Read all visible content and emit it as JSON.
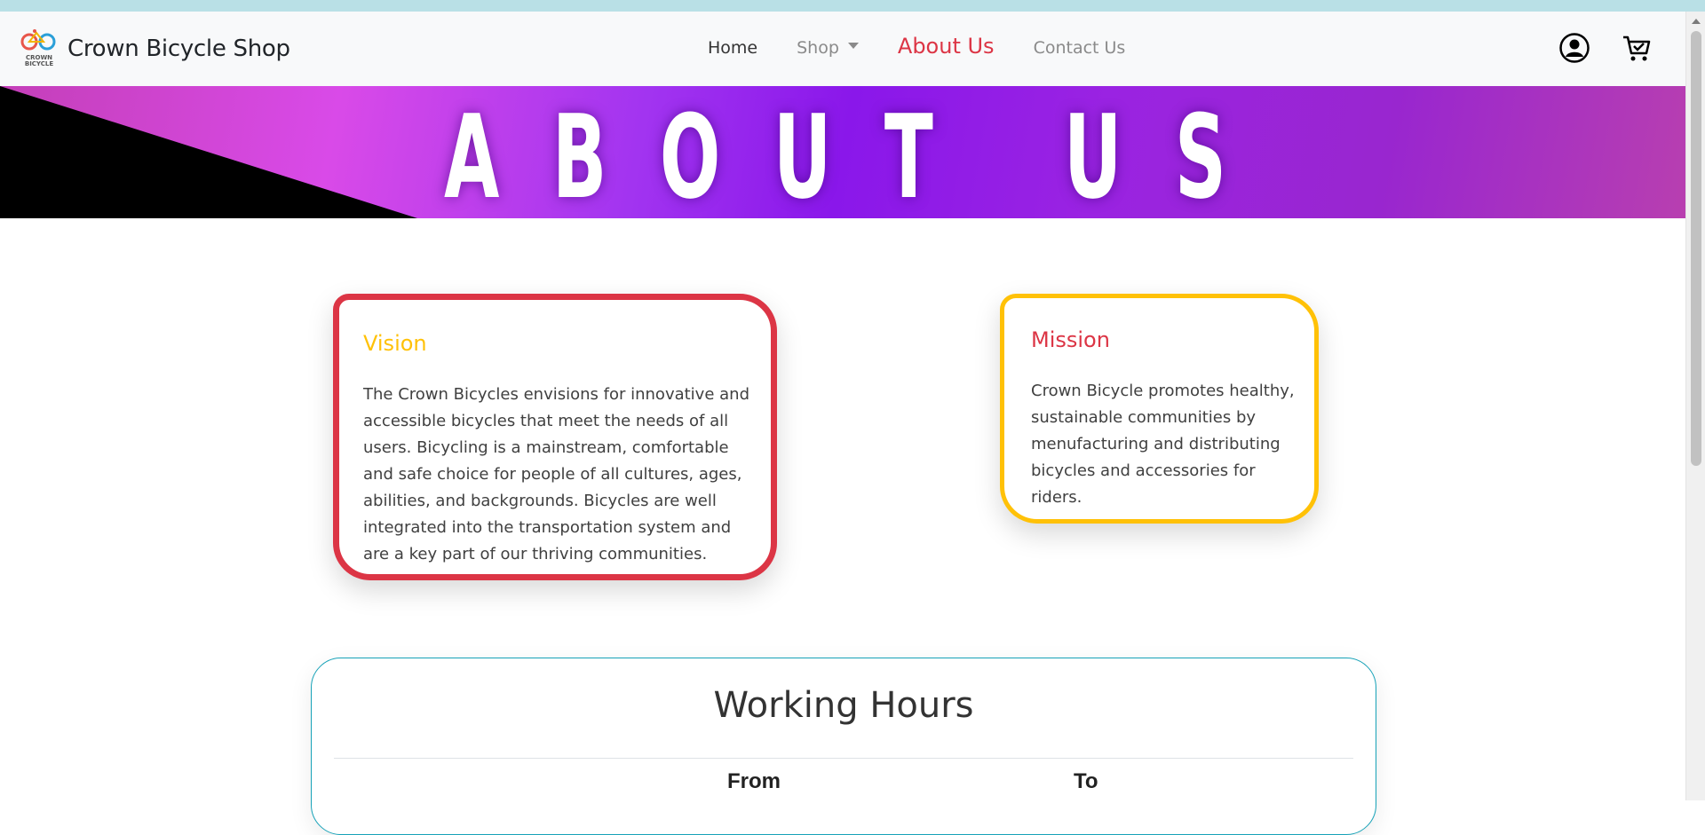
{
  "brand": {
    "name": "Crown Bicycle Shop",
    "logo_text": "CROWN BICYCLE"
  },
  "nav": {
    "home": "Home",
    "shop": "Shop",
    "about": "About Us",
    "contact": "Contact Us",
    "icons": [
      "user-circle-icon",
      "cart-icon"
    ]
  },
  "banner": {
    "title": "ABOUT US"
  },
  "vision": {
    "title": "Vision",
    "text": "The Crown Bicycles envisions for innovative and accessible bicycles that meet the needs of all users. Bicycling is a mainstream, comfortable and safe choice for people of all cultures, ages, abilities, and backgrounds. Bicycles are well integrated into the transportation system and are a key part of our thriving communities."
  },
  "mission": {
    "title": "Mission",
    "text": "Crown Bicycle promotes healthy, sustainable communities by menufacturing and distributing bicycles and accessories for riders."
  },
  "hours": {
    "title": "Working Hours",
    "col_from": "From",
    "col_to": "To"
  },
  "colors": {
    "accent_red": "#dc3545",
    "accent_yellow": "#ffc107",
    "accent_teal": "#17a2b8",
    "banner_purple": "#8a17ea"
  }
}
